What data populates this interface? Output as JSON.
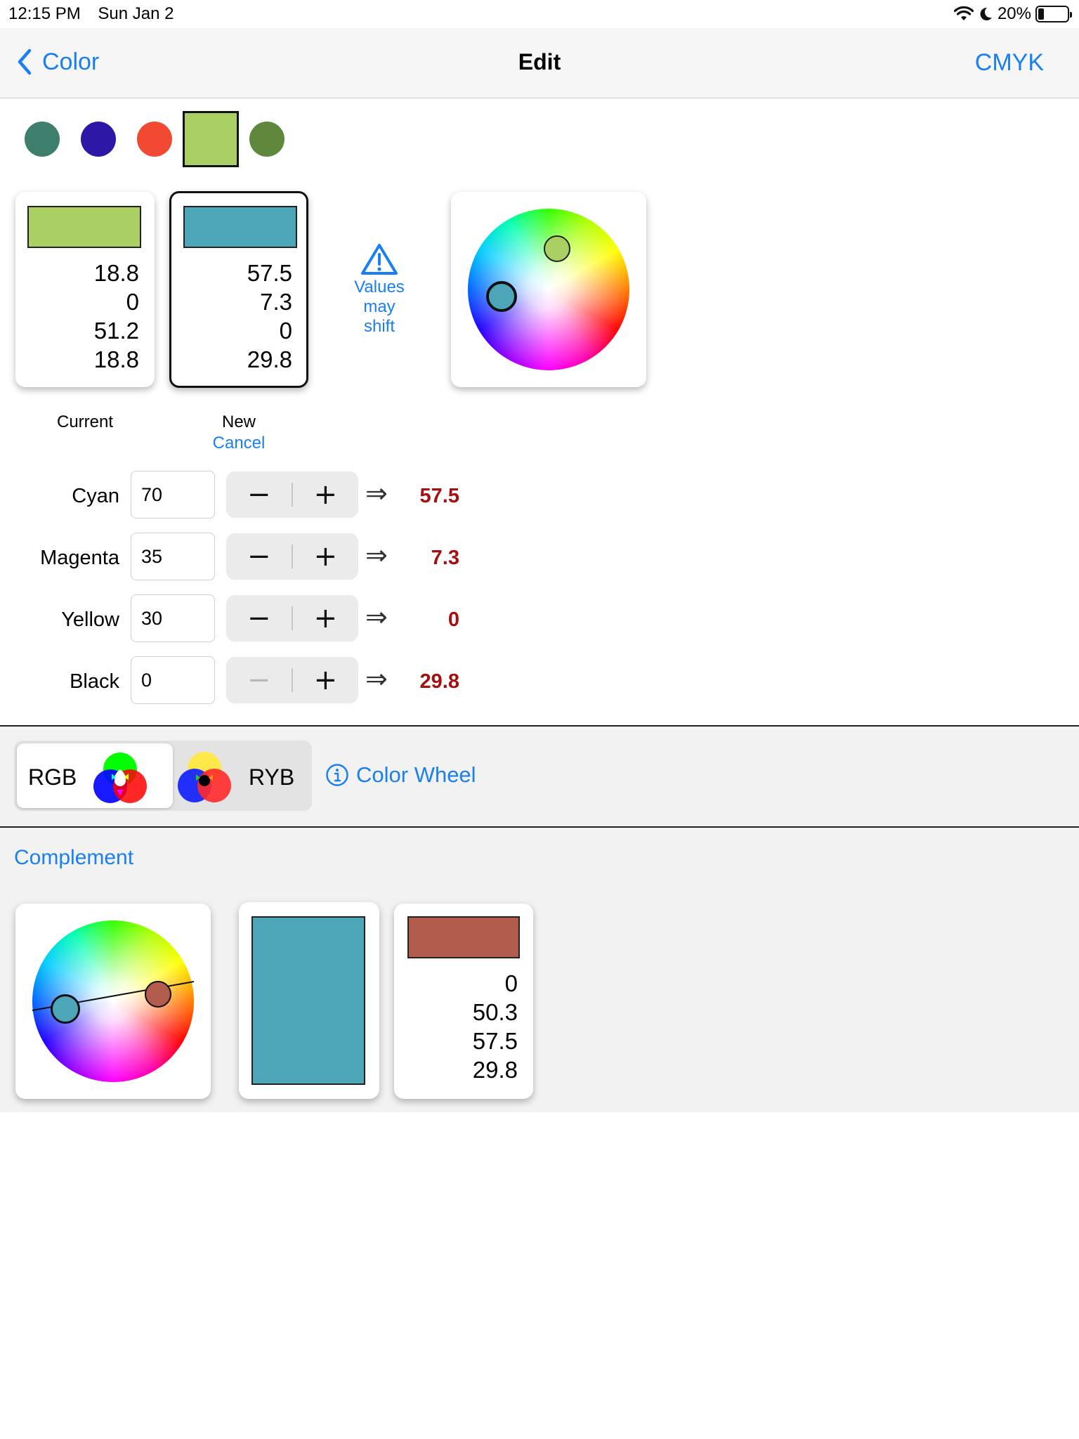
{
  "status_bar": {
    "time": "12:15 PM",
    "date": "Sun Jan 2",
    "battery": "20%",
    "battery_level": 0.2
  },
  "nav": {
    "back_label": "Color",
    "title": "Edit",
    "right_label": "CMYK"
  },
  "swatches": [
    {
      "color": "#3d7e6c"
    },
    {
      "color": "#2c17a7"
    },
    {
      "color": "#f24a32"
    },
    {
      "color": "#aad063",
      "selected": true
    },
    {
      "color": "#5f883c"
    }
  ],
  "current": {
    "color": "#aad063",
    "values": [
      "18.8",
      "0",
      "51.2",
      "18.8"
    ],
    "caption": "Current"
  },
  "new": {
    "color": "#4da6b8",
    "values": [
      "57.5",
      "7.3",
      "0",
      "29.8"
    ],
    "caption": "New",
    "cancel": "Cancel"
  },
  "warning": {
    "line1": "Values",
    "line2": "may",
    "line3": "shift"
  },
  "rows": [
    {
      "label": "Cyan",
      "value": "70",
      "result": "57.5"
    },
    {
      "label": "Magenta",
      "value": "35",
      "result": "7.3"
    },
    {
      "label": "Yellow",
      "value": "30",
      "result": "0"
    },
    {
      "label": "Black",
      "value": "0",
      "result": "29.8"
    }
  ],
  "mode": {
    "rgb": "RGB",
    "ryb": "RYB",
    "selected": "RGB",
    "info_label": "Color Wheel"
  },
  "complement": {
    "label": "Complement",
    "fill_color": "#4da6b8",
    "color": "#b15c4d",
    "values": [
      "0",
      "50.3",
      "57.5",
      "29.8"
    ]
  },
  "colors": {
    "accent": "#1a7ff0",
    "result": "#a50f0f"
  }
}
